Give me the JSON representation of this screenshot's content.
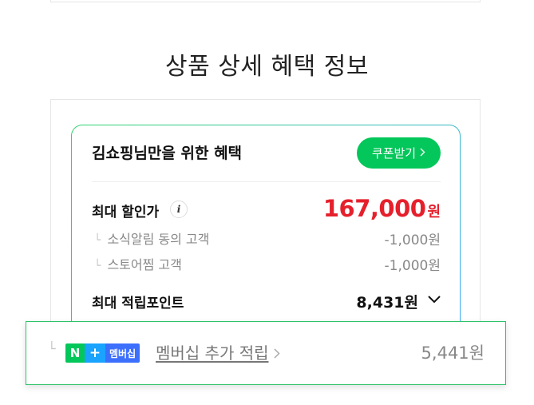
{
  "section_title": "상품 상세 혜택 정보",
  "card": {
    "title": "김쇼핑님만을 위한 혜택",
    "coupon_button": "쿠폰받기",
    "max_discount_label": "최대 할인가",
    "info_icon": "info-icon",
    "price_number": "167,000",
    "price_unit": "원",
    "sub_rows": [
      {
        "label": "소식알림 동의 고객",
        "value": "-1,000원"
      },
      {
        "label": "스토어찜 고객",
        "value": "-1,000원"
      }
    ],
    "max_points_label": "최대 적립포인트",
    "max_points_value": "8,431원"
  },
  "membership": {
    "badge_n": "N",
    "badge_plus": "+",
    "badge_text": "멤버십",
    "link_label": "멤버십 추가 적립",
    "value": "5,441원"
  },
  "colors": {
    "accent_green": "#03c75a",
    "price_red": "#e5202c",
    "npay_blue": "#3d6ffd"
  }
}
